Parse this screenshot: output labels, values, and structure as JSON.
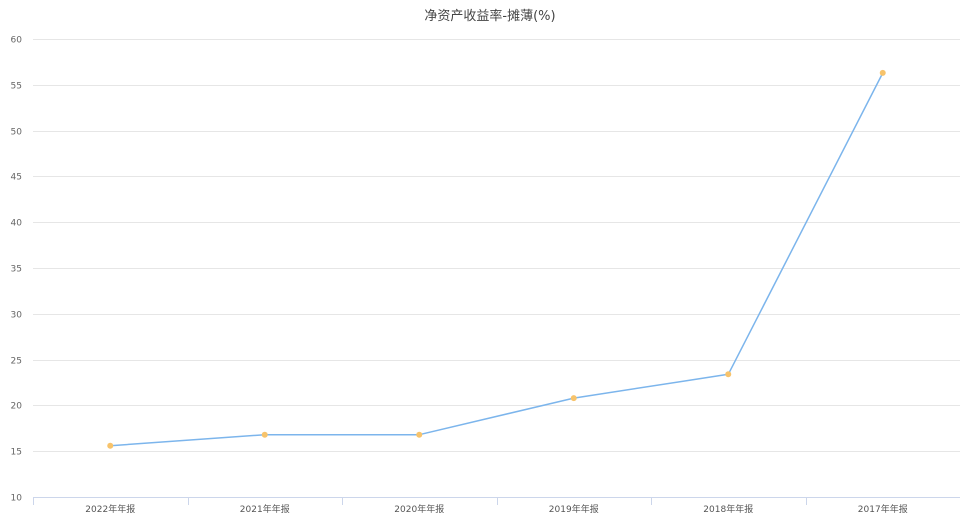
{
  "chart_data": {
    "type": "line",
    "title": "净资产收益率-摊薄(%)",
    "xlabel": "",
    "ylabel": "",
    "categories": [
      "2022年年报",
      "2021年年报",
      "2020年年报",
      "2019年年报",
      "2018年年报",
      "2017年年报"
    ],
    "series": [
      {
        "values": [
          15.6,
          16.8,
          16.8,
          20.8,
          23.4,
          56.3
        ]
      }
    ],
    "ylim": [
      10,
      60
    ],
    "yticks": [
      10,
      15,
      20,
      25,
      30,
      35,
      40,
      45,
      50,
      55,
      60
    ],
    "grid": true,
    "legend": "none",
    "colors": {
      "line": "#7cb5ec",
      "marker": "#f7c36b",
      "grid": "#e6e6e6",
      "axis": "#ccd6eb"
    }
  }
}
